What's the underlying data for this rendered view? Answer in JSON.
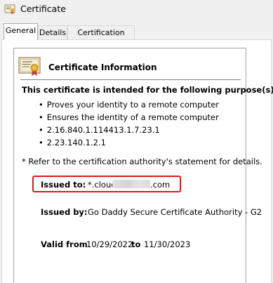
{
  "window": {
    "title": "Certificate"
  },
  "tabs": [
    {
      "label": "General",
      "active": true
    },
    {
      "label": "Details",
      "active": false
    },
    {
      "label": "Certification Path",
      "active": false
    }
  ],
  "info": {
    "title": "Certificate Information",
    "purpose_heading": "This certificate is intended for the following purpose(s):",
    "purposes": [
      "Proves your identity to a remote computer",
      "Ensures the identity of a remote computer",
      "2.16.840.1.114413.1.7.23.1",
      "2.23.140.1.2.1"
    ],
    "refer_note": "* Refer to the certification authority's statement for details."
  },
  "issued_to": {
    "label": "Issued to:",
    "value_prefix": "*.cloud.",
    "value_suffix": ".com"
  },
  "issued_by": {
    "label": "Issued by:",
    "value": "Go Daddy Secure Certificate Authority - G2"
  },
  "validity": {
    "label": "Valid from",
    "from": "10/29/2022",
    "to_label": "to",
    "to": "11/30/2023"
  },
  "colors": {
    "highlight_border": "#e01818"
  }
}
